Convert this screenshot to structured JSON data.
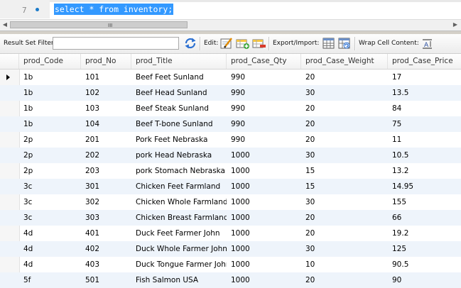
{
  "editor": {
    "line_number": "7",
    "sql": "select * from inventory;"
  },
  "scrollbar": {
    "left_arrow_icon": "arrow-left-icon",
    "right_arrow_icon": "arrow-right-icon",
    "grip_text": "III"
  },
  "toolbar": {
    "filter_label": "Result Set Filter:",
    "filter_value": "",
    "edit_label": "Edit:",
    "export_label": "Export/Import:",
    "wrap_label": "Wrap Cell Content:",
    "icons": [
      "refresh-icon",
      "edit-row-icon",
      "add-row-icon",
      "delete-row-icon",
      "export-icon",
      "import-icon",
      "wrap-text-icon"
    ]
  },
  "grid": {
    "columns": [
      "prod_Code",
      "prod_No",
      "prod_Title",
      "prod_Case_Qty",
      "prod_Case_Weight",
      "prod_Case_Price"
    ],
    "rows": [
      [
        "1b",
        "101",
        "Beef Feet Sunland",
        "990",
        "20",
        "17"
      ],
      [
        "1b",
        "102",
        "Beef Head Sunland",
        "990",
        "30",
        "13.5"
      ],
      [
        "1b",
        "103",
        "Beef Steak Sunland",
        "990",
        "20",
        "84"
      ],
      [
        "1b",
        "104",
        "Beef T-bone Sunland",
        "990",
        "20",
        "75"
      ],
      [
        "2p",
        "201",
        "Pork Feet Nebraska",
        "990",
        "20",
        "11"
      ],
      [
        "2p",
        "202",
        "pork Head Nebraska",
        "1000",
        "30",
        "10.5"
      ],
      [
        "2p",
        "203",
        "pork Stomach Nebraska",
        "1000",
        "15",
        "13.2"
      ],
      [
        "3c",
        "301",
        "Chicken Feet Farmland",
        "1000",
        "15",
        "14.95"
      ],
      [
        "3c",
        "302",
        "Chicken Whole Farmland",
        "1000",
        "30",
        "155"
      ],
      [
        "3c",
        "303",
        "Chicken Breast Farmland",
        "1000",
        "20",
        "66"
      ],
      [
        "4d",
        "401",
        "Duck Feet Farmer John",
        "1000",
        "20",
        "19.2"
      ],
      [
        "4d",
        "402",
        "Duck Whole Farmer John",
        "1000",
        "30",
        "125"
      ],
      [
        "4d",
        "403",
        "Duck Tongue Farmer John",
        "1000",
        "10",
        "90.5"
      ],
      [
        "5f",
        "501",
        "Fish Salmon USA",
        "1000",
        "20",
        "90"
      ]
    ]
  }
}
